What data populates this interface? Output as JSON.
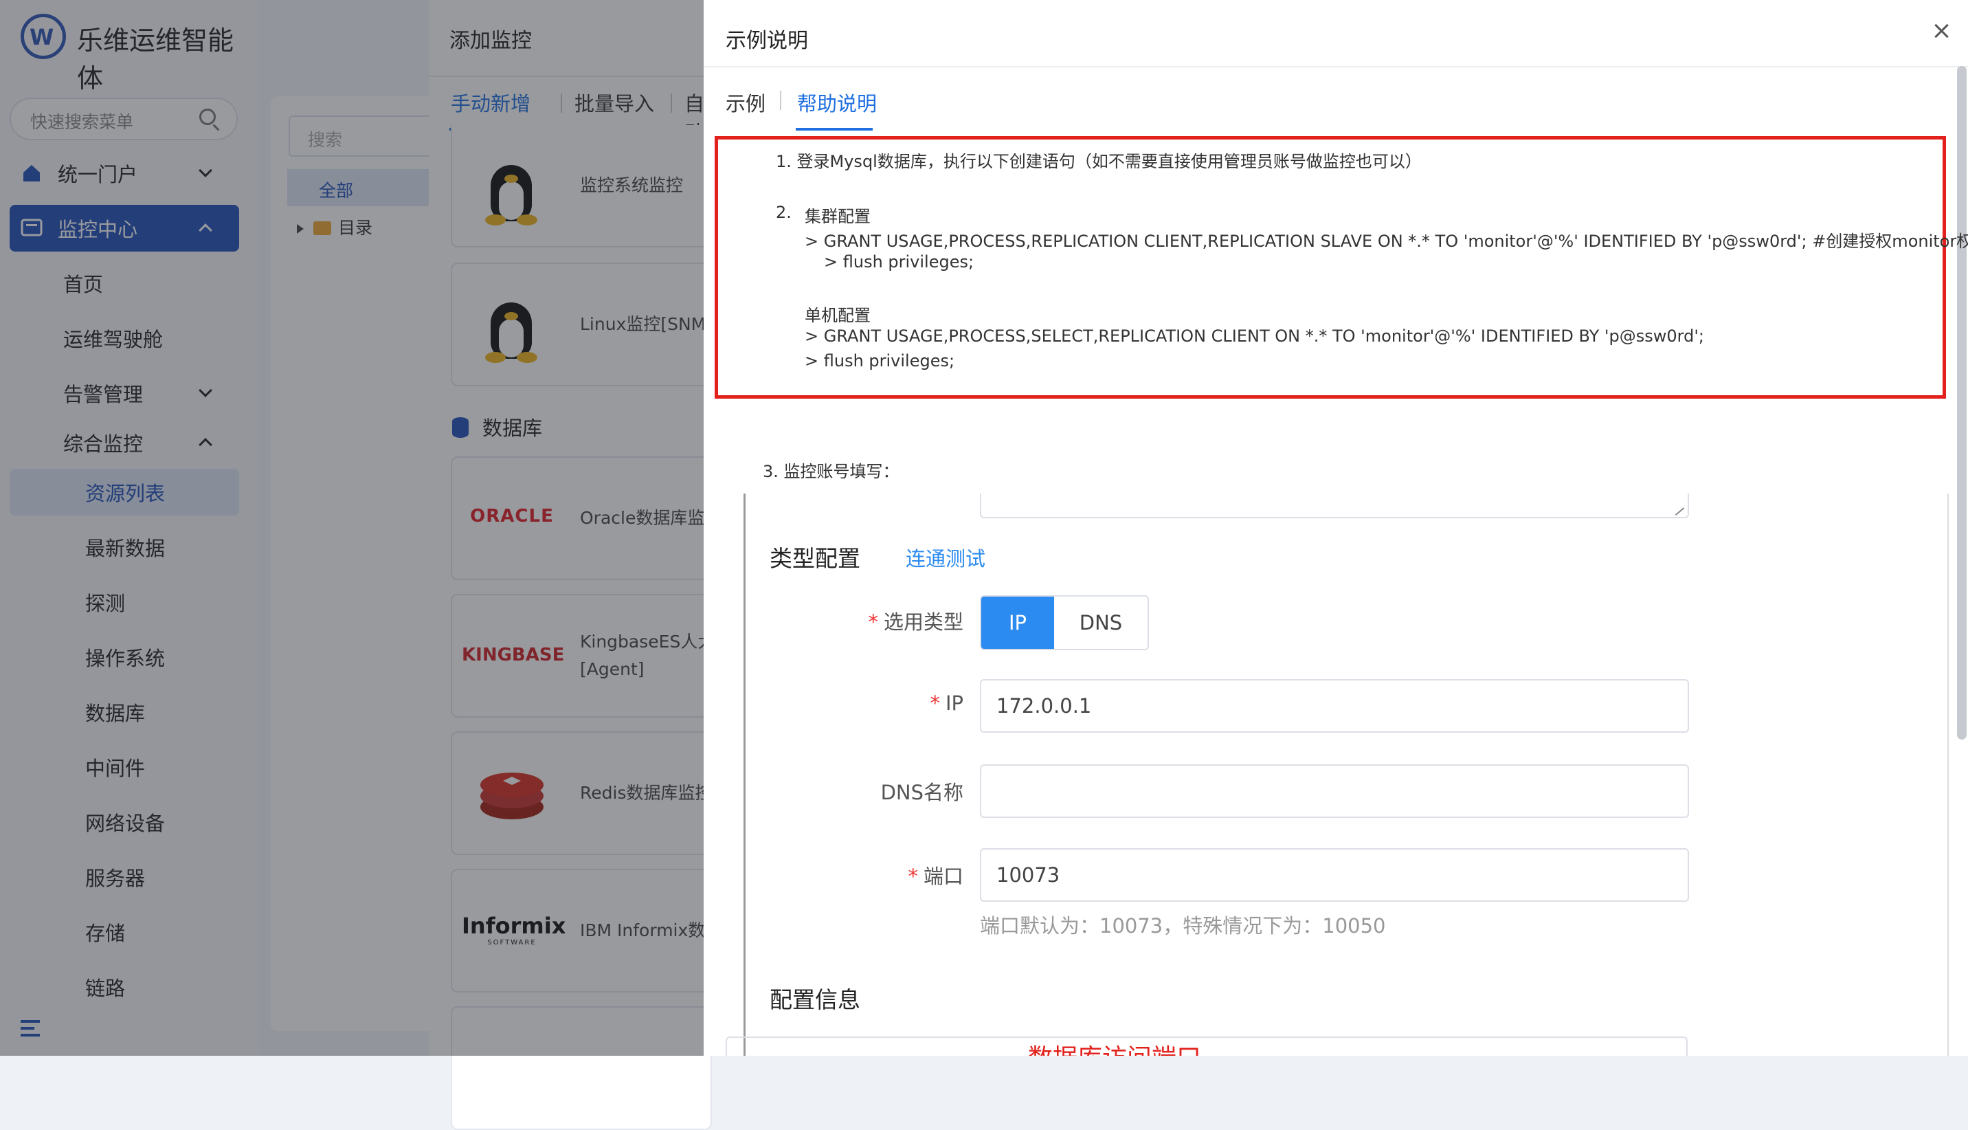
{
  "sidebar": {
    "logo_text": "乐维运维智能体",
    "logo_letter": "W",
    "search_placeholder": "快速搜索菜单",
    "items": [
      {
        "label": "统一门户"
      },
      {
        "label": "监控中心"
      },
      {
        "label": "首页"
      },
      {
        "label": "运维驾驶舱"
      },
      {
        "label": "告警管理"
      },
      {
        "label": "综合监控"
      },
      {
        "label": "资源列表"
      },
      {
        "label": "最新数据"
      },
      {
        "label": "探测"
      },
      {
        "label": "操作系统"
      },
      {
        "label": "数据库"
      },
      {
        "label": "中间件"
      },
      {
        "label": "网络设备"
      },
      {
        "label": "服务器"
      },
      {
        "label": "存储"
      },
      {
        "label": "链路"
      }
    ]
  },
  "tree": {
    "search_placeholder": "搜索",
    "all_label": "全部",
    "dir_label": "目录"
  },
  "add_panel": {
    "title": "添加监控",
    "tabs": [
      "手动新增",
      "批量导入",
      "自动"
    ],
    "cards": [
      {
        "label": "监控系统监控"
      },
      {
        "label": "Linux监控[SNMP"
      },
      {
        "label": "Oracle数据库监控",
        "logo": "ORACLE"
      },
      {
        "label": "KingbaseES人大",
        "label2": "[Agent]",
        "logo": "KINGBASE"
      },
      {
        "label": "Redis数据库监控"
      },
      {
        "label": "IBM Informix数据",
        "logo": "Informix",
        "logo_sub": "SOFTWARE"
      }
    ],
    "section_db": "数据库"
  },
  "dialog": {
    "title": "示例说明",
    "tabs": [
      "示例",
      "帮助说明"
    ],
    "help": {
      "l1": "1. 登录Mysql数据库，执行以下创建语句（如不需要直接使用管理员账号做监控也可以）",
      "l2_num": "2.",
      "l2_title": "集群配置",
      "l2_cmd1": "> GRANT USAGE,PROCESS,REPLICATION CLIENT,REPLICATION SLAVE ON *.* TO 'monitor'@'%' IDENTIFIED BY 'p@ssw0rd'; #创建授权monitor权限;",
      "l2_cmd2": "> flush privileges;",
      "l2b_title": "单机配置",
      "l2b_cmd1": "> GRANT USAGE,PROCESS,SELECT,REPLICATION CLIENT ON *.* TO 'monitor'@'%' IDENTIFIED BY 'p@ssw0rd';",
      "l2b_cmd2": "> flush privileges;",
      "l3": "3. 监控账号填写："
    },
    "shot": {
      "section_type": "类型配置",
      "link_test": "连通测试",
      "label_type": "选用类型",
      "opt_ip": "IP",
      "opt_dns": "DNS",
      "label_ip": "IP",
      "ip_value": "172.0.0.1",
      "label_dns": "DNS名称",
      "dns_value": "",
      "label_port": "端口",
      "port_value": "10073",
      "port_hint": "端口默认为：10073，特殊情况下为：10050",
      "section_config": "配置信息",
      "config_red": "数据库访问端口"
    }
  },
  "colors": {
    "brand": "#1f4fb8",
    "link": "#1f6fe0",
    "highlight_border": "#e3211c",
    "overlay": "rgba(40,44,52,0.48)"
  }
}
